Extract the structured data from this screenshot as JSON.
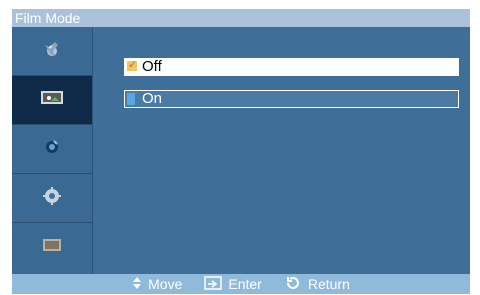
{
  "title": "Film Mode",
  "options": [
    {
      "label": "Off",
      "selected": true
    },
    {
      "label": "On",
      "selected": false
    }
  ],
  "sidebar_items": [
    {
      "icon": "input-icon"
    },
    {
      "icon": "picture-icon"
    },
    {
      "icon": "sound-icon"
    },
    {
      "icon": "setup-icon"
    },
    {
      "icon": "multi-control-icon"
    }
  ],
  "nav": {
    "move": "Move",
    "enter": "Enter",
    "return": "Return"
  },
  "colors": {
    "panel": "#3f6f99",
    "title_bar": "#a9c2da",
    "nav_bar": "#90bad9",
    "selected_sidebar": "#102a4a",
    "check_fill": "#f2c56b",
    "bar_fill": "#56a9e4"
  }
}
